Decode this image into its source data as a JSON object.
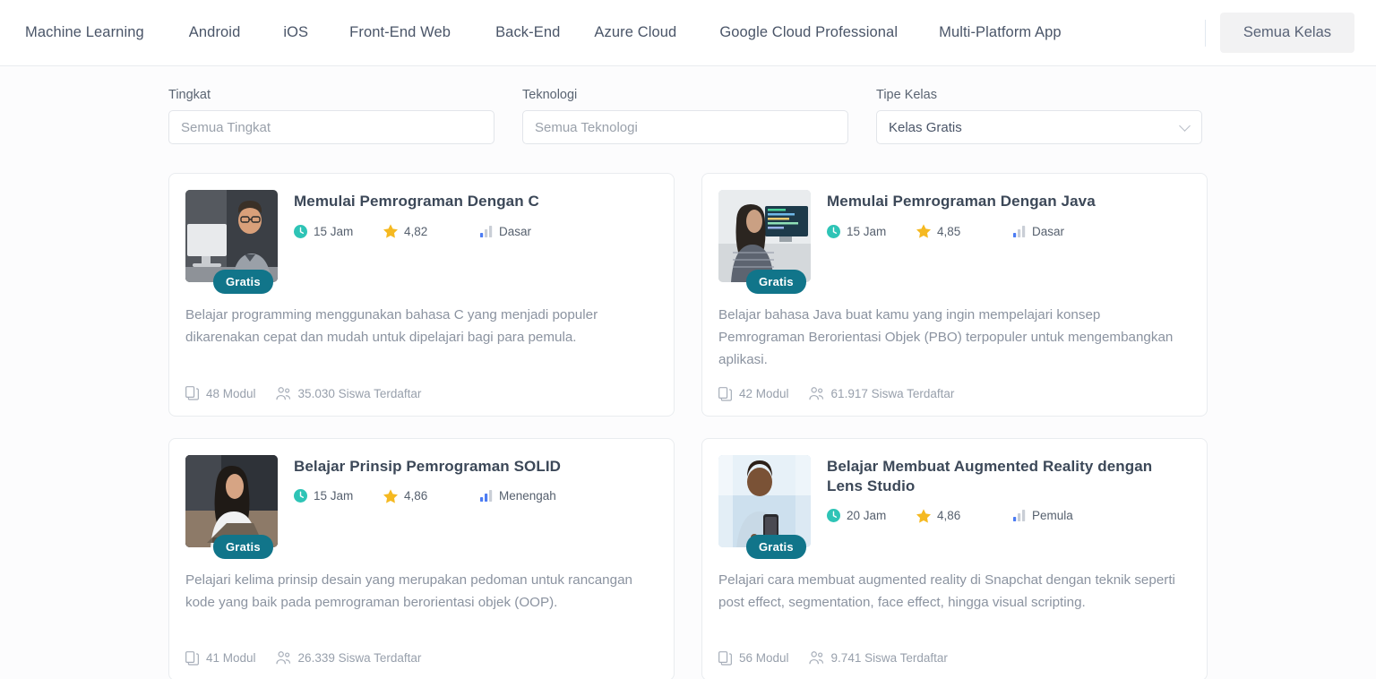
{
  "nav": {
    "items": [
      {
        "label": "Machine Learning"
      },
      {
        "label": "Android"
      },
      {
        "label": "iOS"
      },
      {
        "label": "Front-End Web"
      },
      {
        "label": "Back-End"
      },
      {
        "label": "Azure Cloud"
      },
      {
        "label": "Google Cloud Professional"
      },
      {
        "label": "Multi-Platform App"
      }
    ],
    "cta_label": "Semua Kelas"
  },
  "filters": [
    {
      "label": "Tingkat",
      "value": "Semua Tingkat",
      "placeholder": "Semua Tingkat",
      "is_placeholder": true,
      "has_chevron": false
    },
    {
      "label": "Teknologi",
      "value": "Semua Teknologi",
      "placeholder": "Semua Teknologi",
      "is_placeholder": true,
      "has_chevron": false
    },
    {
      "label": "Tipe Kelas",
      "value": "Kelas Gratis",
      "placeholder": "Kelas Gratis",
      "is_placeholder": false,
      "has_chevron": true
    }
  ],
  "colors": {
    "badge_teal": "#11758a",
    "clock_teal": "#2ec4b6",
    "star_yellow": "#f5b921",
    "level_blue": "#4c7cf3",
    "level_gray": "#c9ced6"
  },
  "cards": [
    {
      "title": "Memulai Pemrograman Dengan C",
      "badge": "Gratis",
      "hours": "15 Jam",
      "rating": "4,82",
      "level": "Dasar",
      "level_bars": 1,
      "description": "Belajar programming menggunakan bahasa C yang menjadi populer dikarenakan cepat dan mudah untuk dipelajari bagi para pemula.",
      "modules": "48 Modul",
      "students": "35.030 Siswa Terdaftar",
      "thumb": "man-at-desktop-computer"
    },
    {
      "title": "Memulai Pemrograman Dengan Java",
      "badge": "Gratis",
      "hours": "15 Jam",
      "rating": "4,85",
      "level": "Dasar",
      "level_bars": 1,
      "description": "Belajar bahasa Java buat kamu yang ingin mempelajari konsep Pemrograman Berorientasi Objek (PBO) terpopuler untuk mengembangkan aplikasi.",
      "modules": "42 Modul",
      "students": "61.917 Siswa Terdaftar",
      "thumb": "woman-at-monitor"
    },
    {
      "title": "Belajar Prinsip Pemrograman SOLID",
      "badge": "Gratis",
      "hours": "15 Jam",
      "rating": "4,86",
      "level": "Menengah",
      "level_bars": 2,
      "description": "Pelajari kelima prinsip desain yang merupakan pedoman untuk rancangan kode yang baik pada pemrograman berorientasi objek (OOP).",
      "modules": "41 Modul",
      "students": "26.339 Siswa Terdaftar",
      "thumb": "woman-with-laptop"
    },
    {
      "title": "Belajar Membuat Augmented Reality dengan Lens Studio",
      "badge": "Gratis",
      "hours": "20 Jam",
      "rating": "4,86",
      "level": "Pemula",
      "level_bars": 1,
      "description": "Pelajari cara membuat augmented reality di Snapchat dengan teknik seperti post effect, segmentation, face effect, hingga visual scripting.",
      "modules": "56 Modul",
      "students": "9.741 Siswa Terdaftar",
      "thumb": "man-with-phone"
    }
  ]
}
